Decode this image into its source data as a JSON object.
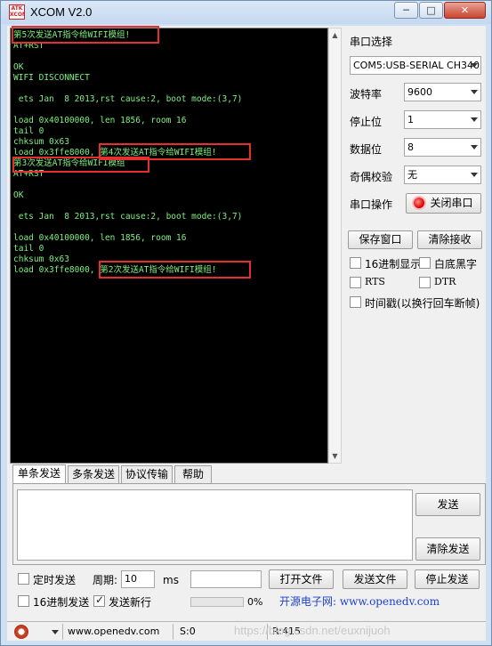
{
  "window": {
    "title": "XCOM V2.0",
    "logo_text": "ATK XCOM",
    "min_glyph": "─",
    "max_glyph": "□",
    "close_glyph": "✕"
  },
  "terminal": {
    "lines": [
      "第5次发送AT指令给WIFI模组!",
      "AT+RST",
      "",
      "OK",
      "WIFI DISCONNECT",
      "",
      " ets Jan  8 2013,rst cause:2, boot mode:(3,7)",
      "",
      "load 0x40100000, len 1856, room 16",
      "tail 0",
      "chksum 0x63",
      "load 0x3ffe8000, 第4次发送AT指令给WIFI模组!",
      "第3次发送AT指令给WIFI模组",
      "AT+RST",
      "",
      "OK",
      "",
      " ets Jan  8 2013,rst cause:2, boot mode:(3,7)",
      "",
      "load 0x40100000, len 1856, room 16",
      "tail 0",
      "chksum 0x63",
      "load 0x3ffe8000, 第2次发送AT指令给WIFI模组!"
    ],
    "text_color": "#7df07d"
  },
  "settings": {
    "port_select_label": "串口选择",
    "port_value": "COM5:USB-SERIAL CH340",
    "baud_label": "波特率",
    "baud_value": "9600",
    "stopbits_label": "停止位",
    "stopbits_value": "1",
    "databits_label": "数据位",
    "databits_value": "8",
    "parity_label": "奇偶校验",
    "parity_value": "无",
    "port_op_label": "串口操作",
    "close_port_label": "关闭串口",
    "save_window_label": "保存窗口",
    "clear_receive_label": "清除接收",
    "hex_display_label": "16进制显示",
    "white_bg_label": "白底黑字",
    "rts_label": "RTS",
    "dtr_label": "DTR",
    "timestamp_label": "时间戳(以换行回车断帧)"
  },
  "tabs": [
    "单条发送",
    "多条发送",
    "协议传输",
    "帮助"
  ],
  "send": {
    "send_label": "发送",
    "clear_send_label": "清除发送",
    "timed_send_label": "定时发送",
    "period_label": "周期:",
    "period_value": "10",
    "period_unit": "ms",
    "open_file_label": "打开文件",
    "send_file_label": "发送文件",
    "stop_send_label": "停止发送",
    "hex_send_label": "16进制发送",
    "send_newline_label": "发送新行",
    "progress_percent": "0%",
    "progress_value": 0,
    "ad_text": "开源电子网: www.openedv.com"
  },
  "statusbar": {
    "url": "www.openedv.com",
    "sent": "S:0",
    "received": "R:415"
  },
  "watermark": "https://blog.csdn.net/euxnijuoh"
}
